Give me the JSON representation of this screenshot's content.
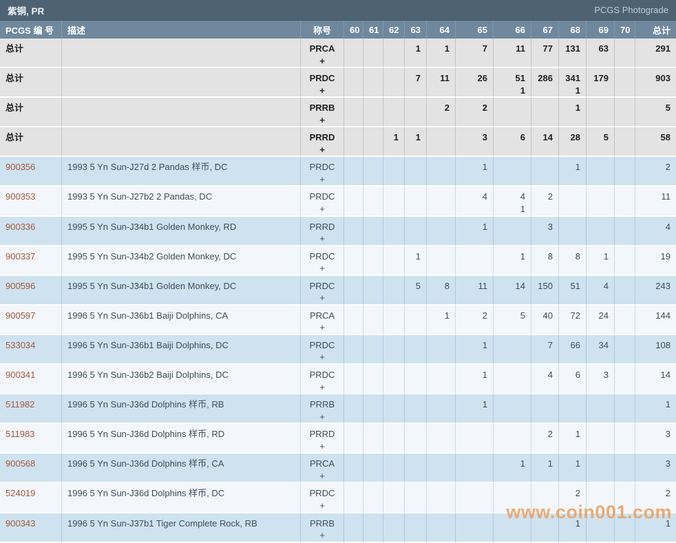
{
  "header": {
    "title": "紫铜, PR",
    "photograde_label": "PCGS Photograde"
  },
  "watermark": "www.coin001.com",
  "colors": {
    "topbar_bg": "#4d6373",
    "table_header_bg": "#6f889d",
    "summary_row_bg": "#e3e3e3",
    "row_blue": "#cfe2f0",
    "row_white": "#f3f6fa",
    "link": "#a3593b",
    "watermark": "#e9a163"
  },
  "table": {
    "columns": [
      "PCGS 编 号",
      "描述",
      "称号",
      "60",
      "61",
      "62",
      "63",
      "64",
      "65",
      "66",
      "67",
      "68",
      "69",
      "70",
      "总计"
    ],
    "summary_rows": [
      {
        "label": "总计",
        "desc": "",
        "desig": "PRCA",
        "desig_plus": "+",
        "grades": [
          "",
          "",
          "",
          "1",
          "1",
          "7",
          "11",
          "77",
          "131",
          "63",
          ""
        ],
        "total": "291"
      },
      {
        "label": "总计",
        "desc": "",
        "desig": "PRDC",
        "desig_plus": "+",
        "grades": [
          "",
          "",
          "",
          "7",
          "11",
          "26",
          "51\n1",
          "286",
          "341\n1",
          "179",
          ""
        ],
        "total": "903"
      },
      {
        "label": "总计",
        "desc": "",
        "desig": "PRRB",
        "desig_plus": "+",
        "grades": [
          "",
          "",
          "",
          "",
          "2",
          "2",
          "",
          "",
          "1",
          "",
          ""
        ],
        "total": "5"
      },
      {
        "label": "总计",
        "desc": "",
        "desig": "PRRD",
        "desig_plus": "+",
        "grades": [
          "",
          "",
          "1",
          "1",
          "",
          "3",
          "6",
          "14",
          "28",
          "5",
          ""
        ],
        "total": "58"
      }
    ],
    "rows": [
      {
        "pcgs": "900356",
        "desc": "1993 5 Yn Sun-J27d 2 Pandas 样币, DC",
        "desig": "PRDC",
        "desig_plus": "+",
        "grades": [
          "",
          "",
          "",
          "",
          "",
          "1",
          "",
          "",
          "1",
          "",
          ""
        ],
        "total": "2"
      },
      {
        "pcgs": "900353",
        "desc": "1993 5 Yn Sun-J27b2 2 Pandas, DC",
        "desig": "PRDC",
        "desig_plus": "+",
        "grades": [
          "",
          "",
          "",
          "",
          "",
          "4",
          "4\n1",
          "2",
          "",
          "",
          ""
        ],
        "total": "11"
      },
      {
        "pcgs": "900336",
        "desc": "1995 5 Yn Sun-J34b1 Golden Monkey, RD",
        "desig": "PRRD",
        "desig_plus": "+",
        "grades": [
          "",
          "",
          "",
          "",
          "",
          "1",
          "",
          "3",
          "",
          "",
          ""
        ],
        "total": "4"
      },
      {
        "pcgs": "900337",
        "desc": "1995 5 Yn Sun-J34b2 Golden Monkey, DC",
        "desig": "PRDC",
        "desig_plus": "+",
        "grades": [
          "",
          "",
          "",
          "1",
          "",
          "",
          "1",
          "8",
          "8",
          "1",
          ""
        ],
        "total": "19"
      },
      {
        "pcgs": "900596",
        "desc": "1995 5 Yn Sun-J34b1 Golden Monkey, DC",
        "desig": "PRDC",
        "desig_plus": "+",
        "grades": [
          "",
          "",
          "",
          "5",
          "8",
          "11",
          "14",
          "150",
          "51",
          "4",
          ""
        ],
        "total": "243"
      },
      {
        "pcgs": "900597",
        "desc": "1996 5 Yn Sun-J36b1 Baiji Dolphins, CA",
        "desig": "PRCA",
        "desig_plus": "+",
        "grades": [
          "",
          "",
          "",
          "",
          "1",
          "2",
          "5",
          "40",
          "72",
          "24",
          ""
        ],
        "total": "144"
      },
      {
        "pcgs": "533034",
        "desc": "1996 5 Yn Sun-J36b1 Baiji Dolphins, DC",
        "desig": "PRDC",
        "desig_plus": "+",
        "grades": [
          "",
          "",
          "",
          "",
          "",
          "1",
          "",
          "7",
          "66",
          "34",
          ""
        ],
        "total": "108"
      },
      {
        "pcgs": "900341",
        "desc": "1996 5 Yn Sun-J36b2 Baiji Dolphins, DC",
        "desig": "PRDC",
        "desig_plus": "+",
        "grades": [
          "",
          "",
          "",
          "",
          "",
          "1",
          "",
          "4",
          "6",
          "3",
          ""
        ],
        "total": "14"
      },
      {
        "pcgs": "511982",
        "desc": "1996 5 Yn Sun-J36d Dolphins 样币, RB",
        "desig": "PRRB",
        "desig_plus": "+",
        "grades": [
          "",
          "",
          "",
          "",
          "",
          "1",
          "",
          "",
          "",
          "",
          ""
        ],
        "total": "1"
      },
      {
        "pcgs": "511983",
        "desc": "1996 5 Yn Sun-J36d Dolphins 样币, RD",
        "desig": "PRRD",
        "desig_plus": "+",
        "grades": [
          "",
          "",
          "",
          "",
          "",
          "",
          "",
          "2",
          "1",
          "",
          ""
        ],
        "total": "3"
      },
      {
        "pcgs": "900568",
        "desc": "1996 5 Yn Sun-J36d Dolphins 样币, CA",
        "desig": "PRCA",
        "desig_plus": "+",
        "grades": [
          "",
          "",
          "",
          "",
          "",
          "",
          "1",
          "1",
          "1",
          "",
          ""
        ],
        "total": "3"
      },
      {
        "pcgs": "524019",
        "desc": "1996 5 Yn Sun-J36d Dolphins 样币, DC",
        "desig": "PRDC",
        "desig_plus": "+",
        "grades": [
          "",
          "",
          "",
          "",
          "",
          "",
          "",
          "",
          "2",
          "",
          ""
        ],
        "total": "2"
      },
      {
        "pcgs": "900343",
        "desc": "1996 5 Yn Sun-J37b1 Tiger Complete Rock, RB",
        "desig": "PRRB",
        "desig_plus": "+",
        "grades": [
          "",
          "",
          "",
          "",
          "",
          "",
          "",
          "",
          "1",
          "",
          ""
        ],
        "total": "1"
      }
    ]
  }
}
